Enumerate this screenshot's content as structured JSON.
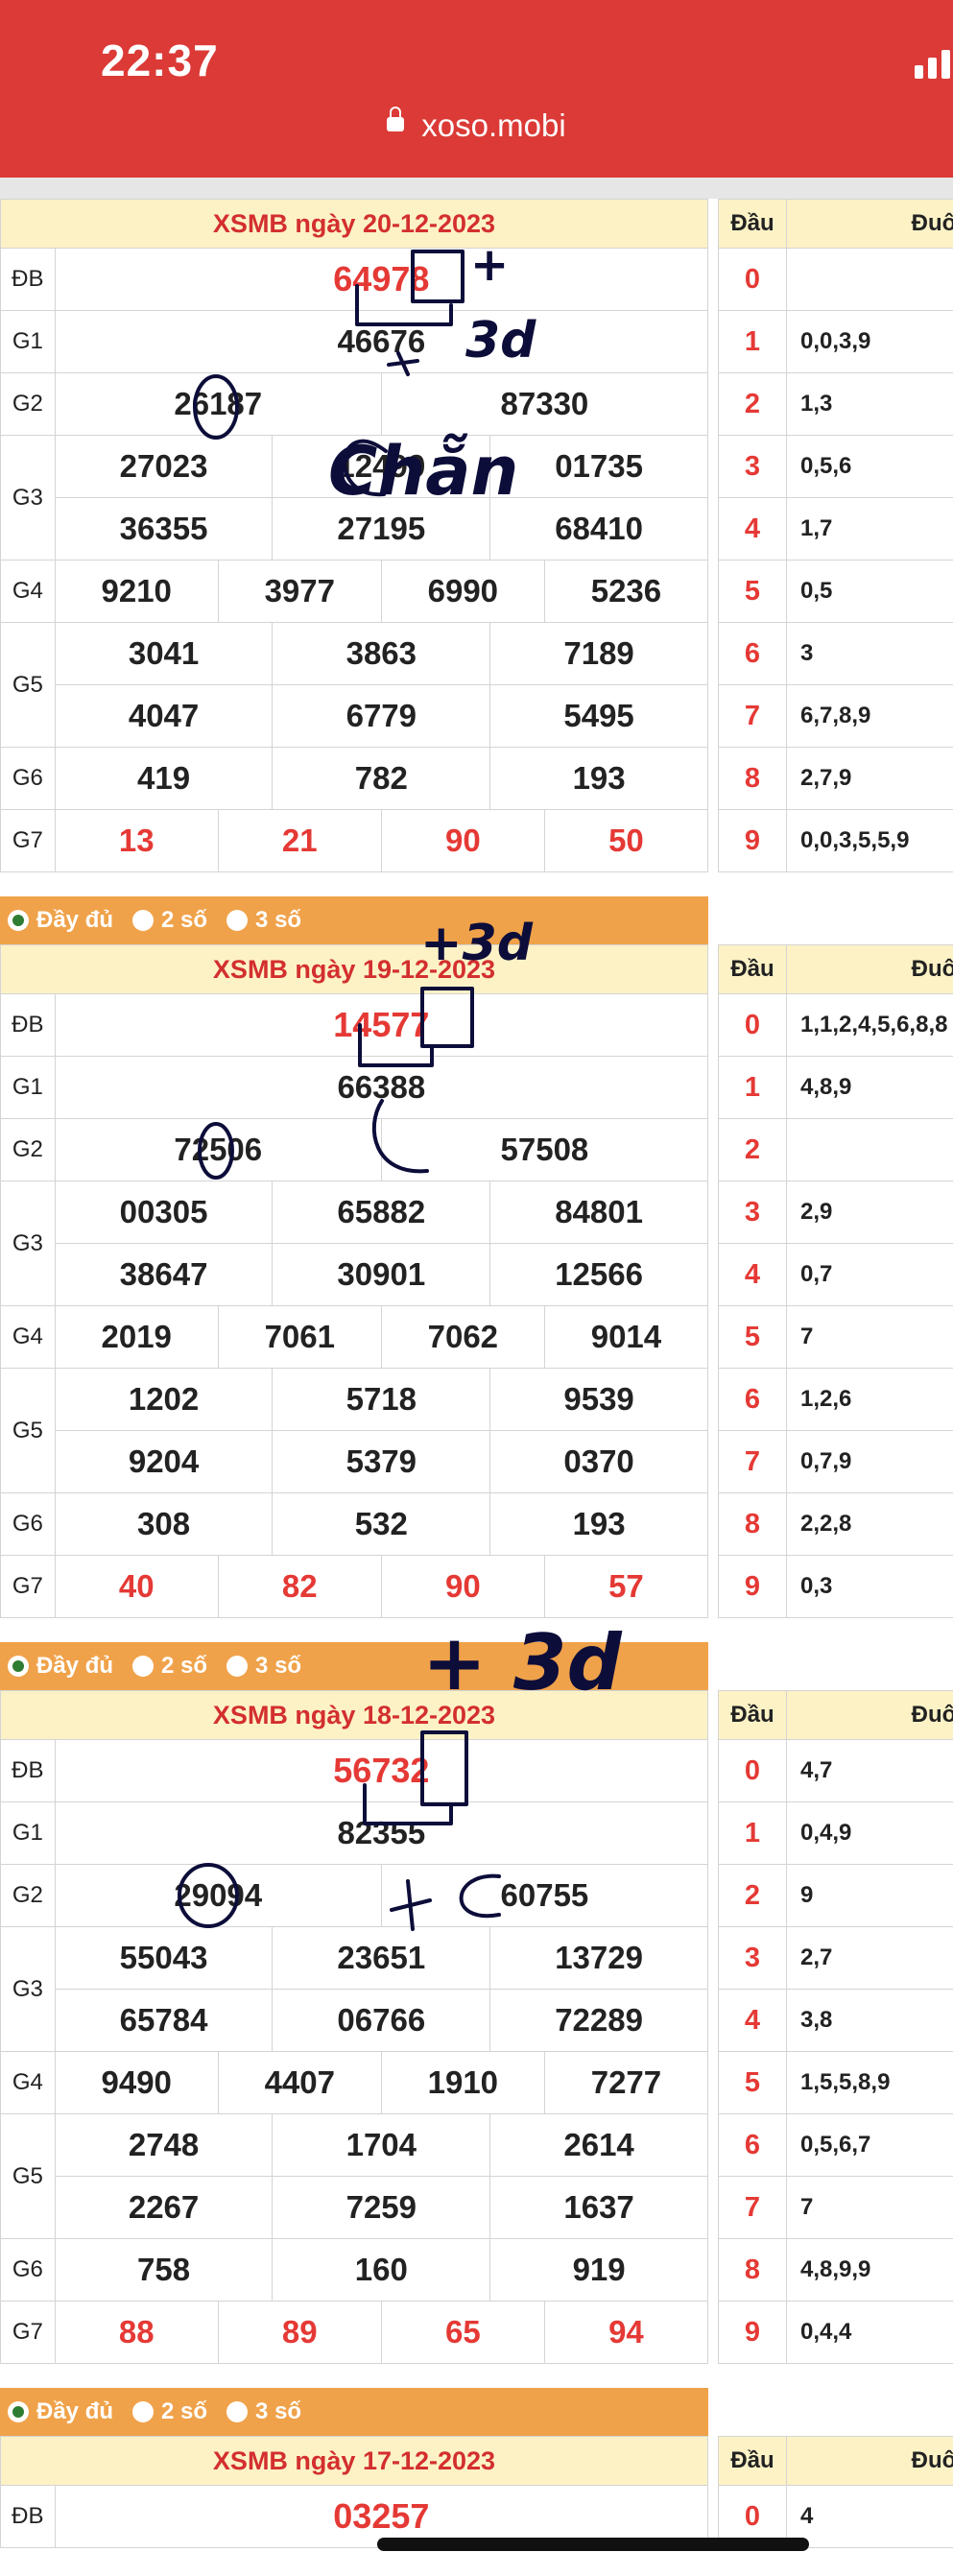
{
  "status": {
    "time": "22:37"
  },
  "browser": {
    "url": "xoso.mobi"
  },
  "options": {
    "full": "Đầy đủ",
    "two": "2 số",
    "three": "3 số"
  },
  "loto_header": {
    "dau": "Đầu",
    "duoi": "Đuôi"
  },
  "draws": [
    {
      "title": "XSMB ngày 20-12-2023",
      "db": "64978",
      "g1": [
        "46676"
      ],
      "g2": [
        "26187",
        "87330"
      ],
      "g3": [
        "27023",
        "12499",
        "01735",
        "36355",
        "27195",
        "68410"
      ],
      "g4": [
        "9210",
        "3977",
        "6990",
        "5236"
      ],
      "g5": [
        "3041",
        "3863",
        "7189",
        "4047",
        "6779",
        "5495"
      ],
      "g6": [
        "419",
        "782",
        "193"
      ],
      "g7": [
        "13",
        "21",
        "90",
        "50"
      ],
      "loto": [
        "",
        "0,0,3,9",
        "1,3",
        "0,5,6",
        "1,7",
        "0,5",
        "3",
        "6,7,8,9",
        "2,7,9",
        "0,0,3,5,5,9"
      ]
    },
    {
      "title": "XSMB ngày 19-12-2023",
      "db": "14577",
      "g1": [
        "66388"
      ],
      "g2": [
        "72506",
        "57508"
      ],
      "g3": [
        "00305",
        "65882",
        "84801",
        "38647",
        "30901",
        "12566"
      ],
      "g4": [
        "2019",
        "7061",
        "7062",
        "9014"
      ],
      "g5": [
        "1202",
        "5718",
        "9539",
        "9204",
        "5379",
        "0370"
      ],
      "g6": [
        "308",
        "532",
        "193"
      ],
      "g7": [
        "40",
        "82",
        "90",
        "57"
      ],
      "loto": [
        "1,1,2,4,5,6,8,8",
        "4,8,9",
        "",
        "2,9",
        "0,7",
        "7",
        "1,2,6",
        "0,7,9",
        "2,2,8",
        "0,3"
      ]
    },
    {
      "title": "XSMB ngày 18-12-2023",
      "db": "56732",
      "g1": [
        "82355"
      ],
      "g2": [
        "29094",
        "60755"
      ],
      "g3": [
        "55043",
        "23651",
        "13729",
        "65784",
        "06766",
        "72289"
      ],
      "g4": [
        "9490",
        "4407",
        "1910",
        "7277"
      ],
      "g5": [
        "2748",
        "1704",
        "2614",
        "2267",
        "7259",
        "1637"
      ],
      "g6": [
        "758",
        "160",
        "919"
      ],
      "g7": [
        "88",
        "89",
        "65",
        "94"
      ],
      "loto": [
        "4,7",
        "0,4,9",
        "9",
        "2,7",
        "3,8",
        "1,5,5,8,9",
        "0,5,6,7",
        "7",
        "4,8,9,9",
        "0,4,4"
      ]
    },
    {
      "title": "XSMB ngày 17-12-2023",
      "db": "03257",
      "loto": [
        "4"
      ]
    }
  ],
  "labels": {
    "db": "ĐB",
    "g1": "G1",
    "g2": "G2",
    "g3": "G3",
    "g4": "G4",
    "g5": "G5",
    "g6": "G6",
    "g7": "G7"
  },
  "handwriting": {
    "d1_plus": "+",
    "d1_3d": "3d",
    "d1_zero": "0",
    "d1_chan": "Chẵn",
    "d2_3d": "+3d",
    "d2_zero": "0",
    "d3_3d": "+ 3d",
    "d3_zero": "0",
    "d3_plusc": "+C"
  }
}
